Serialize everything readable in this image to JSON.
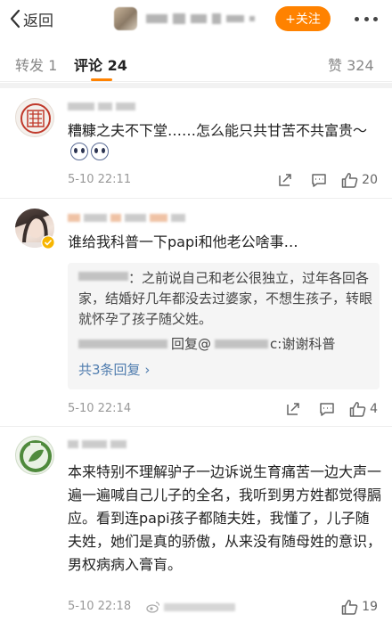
{
  "header": {
    "back_label": "返回",
    "follow_label": "+关注"
  },
  "tabs": {
    "repost": "转发 1",
    "comments": "评论 24",
    "likes": "赞 324"
  },
  "comments": [
    {
      "text": "糟糠之夫不下堂……怎么能只共甘苦不共富贵～",
      "time": "5-10 22:11",
      "likes": "20"
    },
    {
      "text": "谁给我科普一下papi和他老公啥事…",
      "time": "5-10 22:14",
      "likes": "4",
      "reply_preview": {
        "text": "：之前说自己和老公很独立，过年各回各家，结婚好几年都没去过婆家，不想生孩子，转眼就怀孕了孩子随父姓。",
        "reply_mid": "回复@",
        "reply_end": "c:谢谢科普",
        "more": "共3条回复"
      }
    },
    {
      "text": "本来特别不理解驴子一边诉说生育痛苦一边大声一遍一遍喊自己儿子的全名，我听到男方姓都觉得膈应。看到连papi孩子都随夫姓，我懂了，儿子随夫姓，她们是真的骄傲，从来没有随母姓的意识，男权病病入膏肓。",
      "time": "5-10 22:18",
      "likes": "19"
    }
  ],
  "colors": {
    "accent": "#ff8200",
    "link": "#507daf"
  },
  "icons": [
    "chevron-left-icon",
    "more-dots-icon",
    "share-icon",
    "comment-icon",
    "thumbs-up-icon",
    "weibo-logo-icon"
  ]
}
